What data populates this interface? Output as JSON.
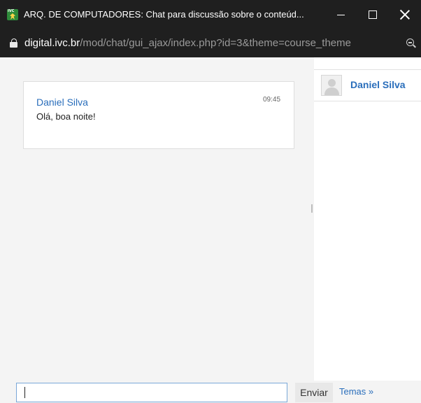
{
  "window": {
    "title": "ARQ. DE COMPUTADORES: Chat para discussão sobre o conteúd...",
    "app_icon_text": "IVC",
    "icons": {
      "app": "ivc-logo-icon",
      "minimize": "minimize-icon",
      "maximize": "maximize-icon",
      "close": "close-icon"
    }
  },
  "address_bar": {
    "host": "digital.ivc.br",
    "path": "/mod/chat/gui_ajax/index.php?id=3&theme=course_theme",
    "icons": {
      "lock": "lock-icon",
      "zoom": "zoom-out-icon"
    }
  },
  "chat": {
    "messages": [
      {
        "author": "Daniel Silva",
        "time": "09:45",
        "text": "Olá, boa noite!"
      }
    ]
  },
  "users": [
    {
      "name": "Daniel Silva",
      "avatar_icon": "default-user-avatar-icon"
    }
  ],
  "input": {
    "value": "",
    "placeholder": "",
    "send_label": "Enviar",
    "themes_label": "Temas »"
  },
  "colors": {
    "chrome_bg": "#1f1f1f",
    "link_blue": "#2a6ebb",
    "page_bg": "#f4f4f4",
    "input_border": "#7aa7d8"
  }
}
